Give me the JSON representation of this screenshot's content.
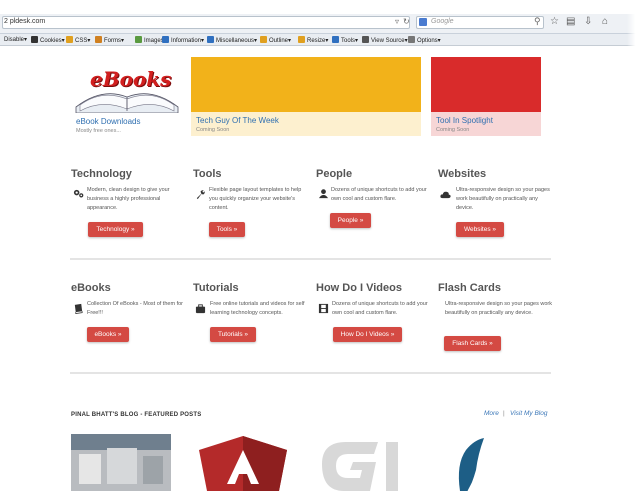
{
  "browser": {
    "url": "2 pldesk.com",
    "search_placeholder": "Google",
    "toolbar": [
      {
        "label": "Disable▾",
        "icon": "disable-icon",
        "color": "#666666"
      },
      {
        "label": "Cookies▾",
        "icon": "cookies-icon",
        "color": "#333333"
      },
      {
        "label": "CSS▾",
        "icon": "css-icon",
        "color": "#e0a020"
      },
      {
        "label": "Forms▾",
        "icon": "forms-icon",
        "color": "#d08020"
      },
      {
        "label": "Images▾",
        "icon": "images-icon",
        "color": "#5a9a40"
      },
      {
        "label": "Information▾",
        "icon": "information-icon",
        "color": "#3070c0"
      },
      {
        "label": "Miscellaneous▾",
        "icon": "miscellaneous-icon",
        "color": "#3070c0"
      },
      {
        "label": "Outline▾",
        "icon": "outline-icon",
        "color": "#e0a020"
      },
      {
        "label": "Resize▾",
        "icon": "resize-icon",
        "color": "#e0a020"
      },
      {
        "label": "Tools▾",
        "icon": "tools-icon",
        "color": "#3070c0"
      },
      {
        "label": "View Source▾",
        "icon": "view-source-icon",
        "color": "#555555"
      },
      {
        "label": "Options▾",
        "icon": "options-icon",
        "color": "#777777"
      }
    ]
  },
  "tiles": [
    {
      "title": "eBook Downloads",
      "subtitle": "Mostly free ones...",
      "logo_text": "eBooks",
      "color": "#ffffff",
      "foot_color": "#ffffff",
      "title_color": "#2f6fb0"
    },
    {
      "title": "Tech Guy Of The Week",
      "subtitle": "Coming Soon",
      "color": "#f2b21a",
      "foot_color": "#fdf0cf",
      "title_color": "#2f6fb0"
    },
    {
      "title": "Tool In Spotlight",
      "subtitle": "Coming Soon",
      "color": "#d92b2b",
      "foot_color": "#f7d6d6",
      "title_color": "#2f6fb0"
    }
  ],
  "sections_row1": [
    {
      "heading": "Technology",
      "text": "Modern, clean design to give your business a highly professional appearance.",
      "button": "Technology »",
      "icon": "gears-icon"
    },
    {
      "heading": "Tools",
      "text": "Flexible page layout templates to help you quickly organize your website's content.",
      "button": "Tools »",
      "icon": "wrench-icon"
    },
    {
      "heading": "People",
      "text": "Dozens of unique shortcuts to add your own cool and custom flare.",
      "button": "People »",
      "icon": "user-icon"
    },
    {
      "heading": "Websites",
      "text": "Ultra-responsive design so your pages work beautifully on practically any device.",
      "button": "Websites »",
      "icon": "cloud-icon"
    }
  ],
  "sections_row2": [
    {
      "heading": "eBooks",
      "text": "Collection Of eBooks - Most of them for Free!!!",
      "button": "eBooks »",
      "icon": "book-icon"
    },
    {
      "heading": "Tutorials",
      "text": "Free online tutorials and videos for self learning technology concepts.",
      "button": "Tutorials »",
      "icon": "briefcase-icon"
    },
    {
      "heading": "How Do I Videos",
      "text": "Dozens of unique shortcuts to add your own cool and custom flare.",
      "button": "How Do I Videos »",
      "icon": "film-icon"
    },
    {
      "heading": "Flash Cards",
      "text": "Ultra-responsive design so your pages work beautifully on practically any device.",
      "button": "Flash Cards »",
      "icon": ""
    }
  ],
  "blog": {
    "heading": "PINAL BHATT'S BLOG - FEATURED POSTS",
    "more": "More",
    "separator": "|",
    "visit": "Visit My Blog"
  },
  "colors": {
    "button": "#d44a43",
    "link": "#3c78b8"
  }
}
